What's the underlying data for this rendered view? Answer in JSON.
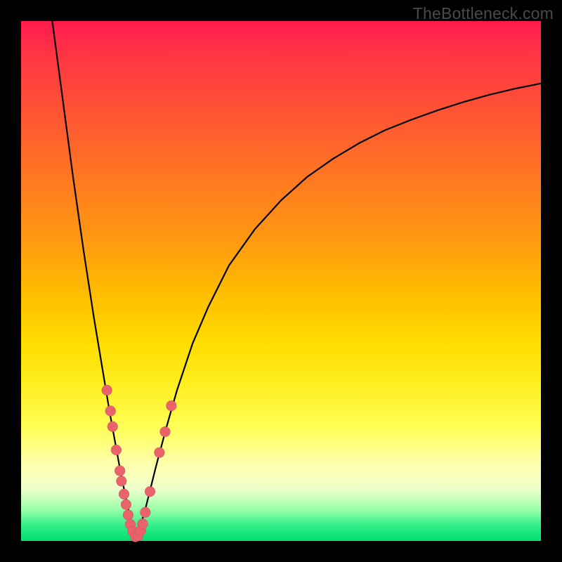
{
  "watermark": "TheBottleneck.com",
  "colors": {
    "frame_bg_top": "#ff1a4d",
    "frame_bg_bottom": "#00e070",
    "curve": "#000000",
    "dots": "#e9636b",
    "page_bg": "#000000"
  },
  "chart_data": {
    "type": "line",
    "title": "",
    "xlabel": "",
    "ylabel": "",
    "xlim": [
      0,
      100
    ],
    "ylim": [
      0,
      100
    ],
    "notch_x": 22,
    "series": [
      {
        "name": "left-branch",
        "x": [
          6,
          8,
          10,
          12,
          14,
          15,
          16,
          17,
          18,
          19,
          20,
          21,
          22
        ],
        "y": [
          100,
          85,
          70,
          56,
          43,
          37,
          31,
          25,
          19.5,
          14,
          9,
          4.5,
          0.5
        ]
      },
      {
        "name": "right-branch",
        "x": [
          22,
          23,
          24,
          25,
          26,
          28,
          30,
          33,
          36,
          40,
          45,
          50,
          55,
          60,
          65,
          70,
          75,
          80,
          85,
          90,
          95,
          100
        ],
        "y": [
          0.5,
          3,
          6.5,
          10.5,
          14.5,
          22,
          29,
          38,
          45,
          53,
          60,
          65.5,
          70,
          73.5,
          76.5,
          79,
          81,
          82.8,
          84.4,
          85.8,
          87,
          88
        ]
      }
    ],
    "scatter": {
      "name": "highlight-dots",
      "points": [
        {
          "x": 16.5,
          "y": 29
        },
        {
          "x": 17.2,
          "y": 25
        },
        {
          "x": 17.6,
          "y": 22
        },
        {
          "x": 18.3,
          "y": 17.5
        },
        {
          "x": 19.0,
          "y": 13.5
        },
        {
          "x": 19.3,
          "y": 11.5
        },
        {
          "x": 19.8,
          "y": 9
        },
        {
          "x": 20.2,
          "y": 7
        },
        {
          "x": 20.6,
          "y": 5
        },
        {
          "x": 21.0,
          "y": 3.2
        },
        {
          "x": 21.5,
          "y": 1.8
        },
        {
          "x": 22.0,
          "y": 0.8
        },
        {
          "x": 22.5,
          "y": 1.0
        },
        {
          "x": 23.0,
          "y": 2.0
        },
        {
          "x": 23.4,
          "y": 3.3
        },
        {
          "x": 23.9,
          "y": 5.5
        },
        {
          "x": 24.8,
          "y": 9.5
        },
        {
          "x": 26.6,
          "y": 17
        },
        {
          "x": 27.7,
          "y": 21
        },
        {
          "x": 28.9,
          "y": 26
        }
      ]
    }
  }
}
